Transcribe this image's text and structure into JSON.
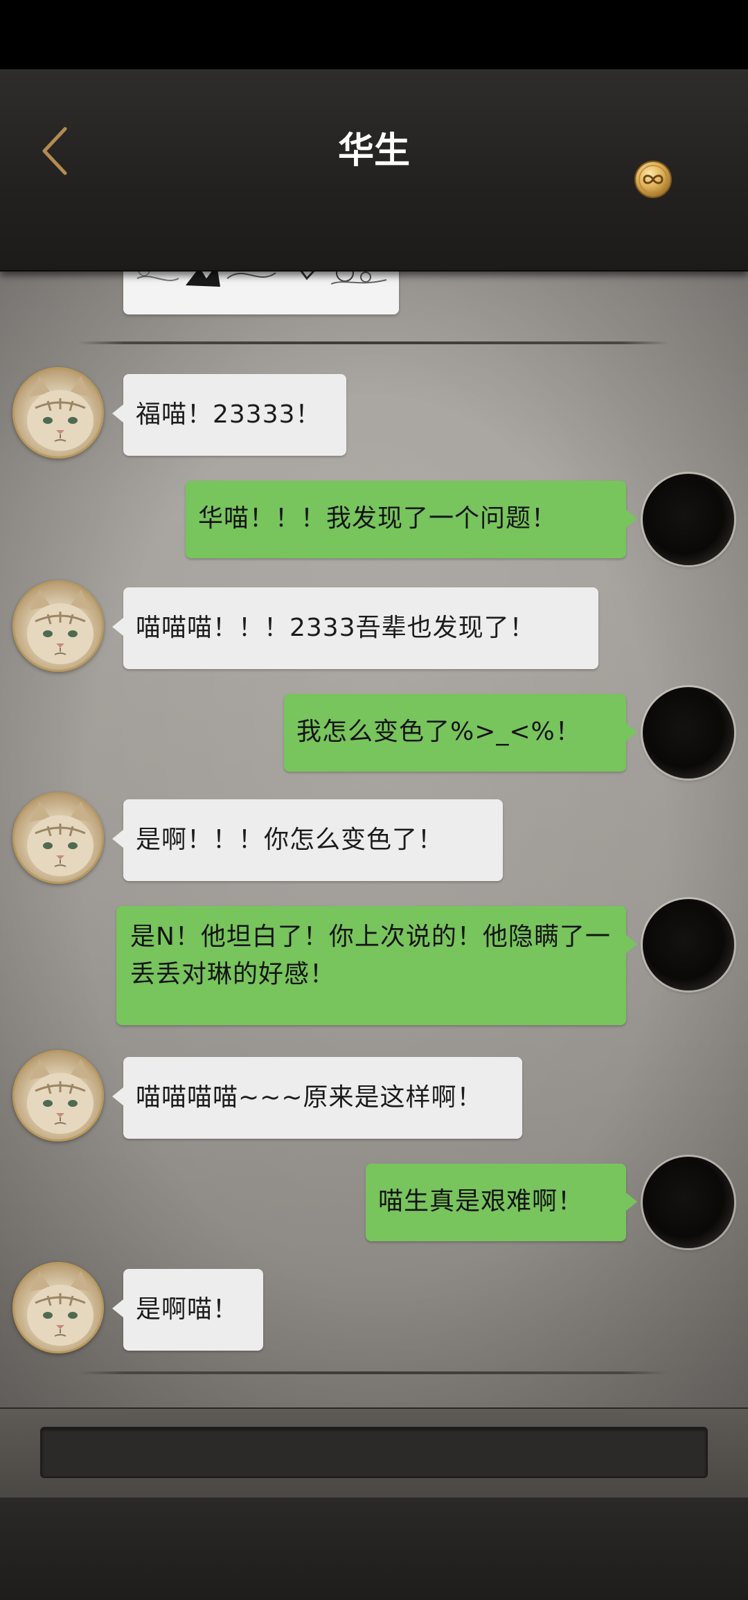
{
  "header": {
    "title": "华生",
    "back_icon": "chevron-left-icon",
    "coin_icon": "infinity-coin-icon",
    "accent_color": "#c9a160"
  },
  "chat": {
    "messages": [
      {
        "side": "left",
        "text": "福喵！23333！"
      },
      {
        "side": "right",
        "text": "华喵！！！我发现了一个问题！"
      },
      {
        "side": "left",
        "text": "喵喵喵！！！2333吾辈也发现了！"
      },
      {
        "side": "right",
        "text": "我怎么变色了%>_<%！"
      },
      {
        "side": "left",
        "text": "是啊！！！你怎么变色了！"
      },
      {
        "side": "right",
        "text": "是N！他坦白了！你上次说的！他隐瞒了一丢丢对琳的好感！"
      },
      {
        "side": "left",
        "text": "喵喵喵喵~~~原来是这样啊！"
      },
      {
        "side": "right",
        "text": "喵生真是艰难啊！"
      },
      {
        "side": "left",
        "text": "是啊喵！"
      }
    ],
    "left_bubble_color": "#ededed",
    "right_bubble_color": "#78c45d"
  },
  "input": {
    "placeholder": ""
  }
}
